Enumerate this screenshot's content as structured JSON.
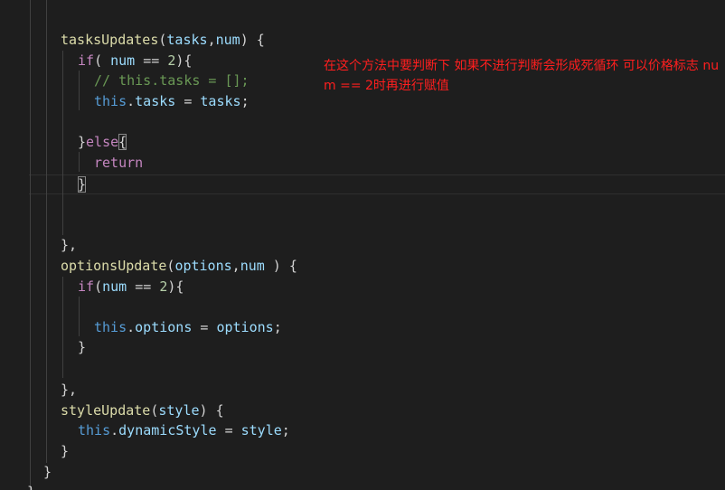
{
  "code": {
    "tasks_fn": "tasksUpdates",
    "tasks_param1": "tasks",
    "tasks_param2": "num",
    "if_kw": "if",
    "num_var": "num",
    "op_eq": "==",
    "two": "2",
    "comment": "// this.tasks = [];",
    "this_kw": "this",
    "prop_tasks": "tasks",
    "assign": "=",
    "val_tasks": "tasks",
    "else_kw": "else",
    "return_kw": "return",
    "options_fn": "optionsUpdate",
    "options_param1": "options",
    "options_param2": "num",
    "prop_options": "options",
    "val_options": "options",
    "style_fn": "styleUpdate",
    "style_param": "style",
    "prop_dynamic": "dynamicStyle",
    "val_style": "style"
  },
  "annotation": {
    "text": "在这个方法中要判断下 如果不进行判断会形成死循环 可以价格标志 num == 2时再进行赋值"
  },
  "colors": {
    "background": "#1e1e1e",
    "annotation": "#ff1e1e",
    "function": "#dcdcaa",
    "parameter": "#9cdcfe",
    "keyword": "#c586c0",
    "this": "#569cd6",
    "number": "#b5cea8",
    "comment": "#6a9955"
  }
}
